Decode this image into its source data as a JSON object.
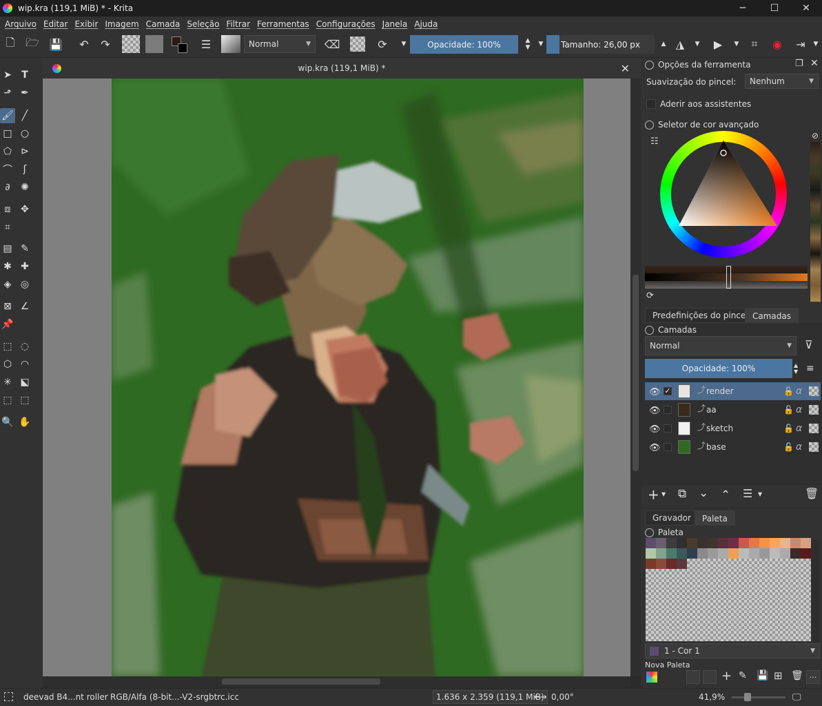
{
  "window": {
    "title": "wip.kra (119,1 MiB) * - Krita",
    "minimize": "─",
    "maximize": "☐",
    "close": "✕"
  },
  "menu": [
    "Arquivo",
    "Editar",
    "Exibir",
    "Imagem",
    "Camada",
    "Seleção",
    "Filtrar",
    "Ferramentas",
    "Configurações",
    "Janela",
    "Ajuda"
  ],
  "toolbar": {
    "blend_mode": "Normal",
    "opacity_label": "Opacidade: 100%",
    "size_label": "Tamanho: 26,00 px"
  },
  "document": {
    "tab_title": "wip.kra (119,1 MiB) *",
    "close": "✕"
  },
  "tool_options": {
    "title": "Opções da ferramenta",
    "smoothing_label": "Suavização do pincel:",
    "smoothing_value": "Nenhum",
    "snap_label": "Aderir aos assistentes"
  },
  "color_selector": {
    "title": "Seletor de cor avançado"
  },
  "dock_tabs_top": [
    "Predefinições do pincel",
    "Camadas"
  ],
  "layers_panel": {
    "title": "Camadas",
    "blend_mode": "Normal",
    "opacity_label": "Opacidade:  100%",
    "layers": [
      {
        "name": "render",
        "selected": true,
        "checked": true
      },
      {
        "name": "aa",
        "selected": false,
        "checked": false
      },
      {
        "name": "sketch",
        "selected": false,
        "checked": false
      },
      {
        "name": "base",
        "selected": false,
        "checked": false
      }
    ]
  },
  "dock_tabs_bottom": [
    "Gravador",
    "Paleta"
  ],
  "palette_panel": {
    "title": "Paleta",
    "current_color": "1 - Cor 1",
    "palette_name": "Nova Paleta",
    "swatches": [
      "#5b4d6e",
      "#6a5f6e",
      "#3d3d3d",
      "#2f2f2f",
      "#4a3a2e",
      "#3b3230",
      "#42332e",
      "#5a2e3a",
      "#6e2e45",
      "#c8594b",
      "#e07a4a",
      "#f2934a",
      "#f5a65b",
      "#e8b48a",
      "#c98a6a",
      "#d8a080",
      "#b0c8a8",
      "#7fa38c",
      "#4a7a6a",
      "#3a5a5a",
      "#2e3e4e",
      "#8a8a8a",
      "#9a9a9a",
      "#aaaaaa",
      "#f0a050",
      "#bbbbbb",
      "#aaaaaa",
      "#999999",
      "#bbbbbb",
      "#aaaaaa",
      "#3a2a2a",
      "#5a1a1a",
      "#7a3a2a",
      "#8a4a3a",
      "#6a2a2a",
      "#5a3a3a"
    ]
  },
  "status": {
    "brush": "deevad B4...nt roller",
    "colorspace": "RGB/Alfa (8-bit...-V2-srgbtrc.icc",
    "dimensions": "1.636 x 2.359 (119,1 MiB)",
    "rotation": "0,00°",
    "zoom": "41,9%"
  },
  "colors": {
    "accent": "#4b6a8c",
    "slider": "#4a76a1",
    "bg": "#323232"
  }
}
